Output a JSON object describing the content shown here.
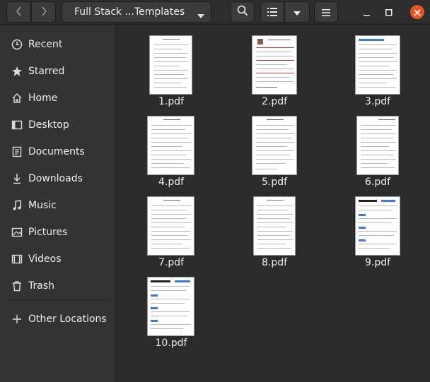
{
  "header": {
    "back_icon": "back-icon",
    "forward_icon": "forward-icon",
    "path_label": "Full Stack ...Templates",
    "search_icon": "search-icon",
    "view_icon": "list-view-icon",
    "view_menu_icon": "chevron-down-icon",
    "menu_icon": "hamburger-menu-icon",
    "minimize_icon": "minimize-icon",
    "maximize_icon": "maximize-icon",
    "close_icon": "close-icon",
    "close_color": "#e95420"
  },
  "sidebar": {
    "items": [
      {
        "label": "Recent",
        "icon": "clock-icon"
      },
      {
        "label": "Starred",
        "icon": "star-icon"
      },
      {
        "label": "Home",
        "icon": "home-icon"
      },
      {
        "label": "Desktop",
        "icon": "desktop-icon"
      },
      {
        "label": "Documents",
        "icon": "document-icon"
      },
      {
        "label": "Downloads",
        "icon": "download-icon"
      },
      {
        "label": "Music",
        "icon": "music-icon"
      },
      {
        "label": "Pictures",
        "icon": "pictures-icon"
      },
      {
        "label": "Videos",
        "icon": "video-icon"
      },
      {
        "label": "Trash",
        "icon": "trash-icon"
      },
      {
        "label": "Other Locations",
        "icon": "plus-icon"
      }
    ]
  },
  "files": [
    {
      "name": "1.pdf"
    },
    {
      "name": "2.pdf"
    },
    {
      "name": "3.pdf"
    },
    {
      "name": "4.pdf"
    },
    {
      "name": "5.pdf"
    },
    {
      "name": "6.pdf"
    },
    {
      "name": "7.pdf"
    },
    {
      "name": "8.pdf"
    },
    {
      "name": "9.pdf"
    },
    {
      "name": "10.pdf"
    }
  ]
}
